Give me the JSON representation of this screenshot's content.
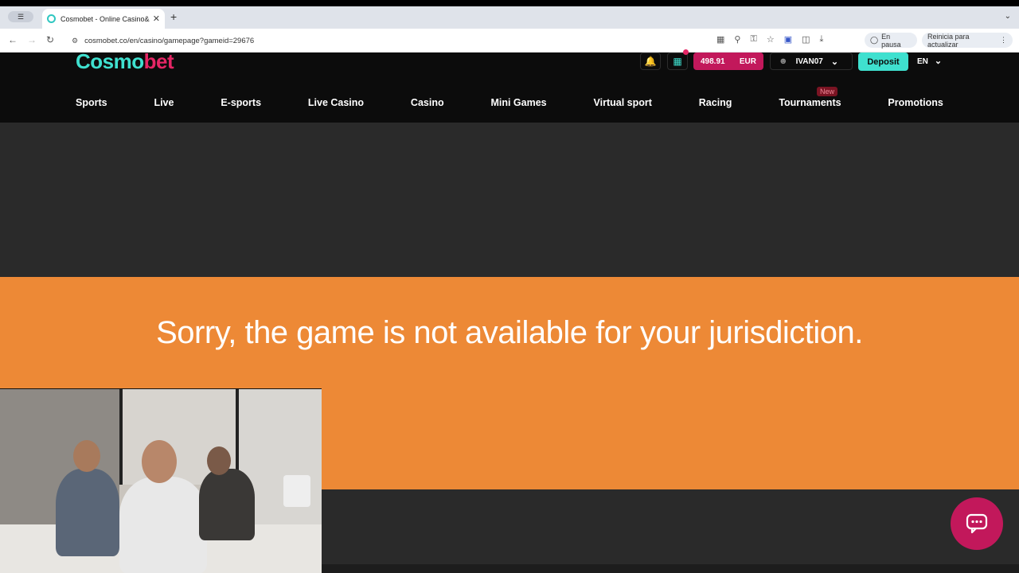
{
  "browser": {
    "tab_title": "Cosmobet - Online Casino&amp;",
    "url": "cosmobet.co/en/casino/gamepage?gameid=29676",
    "pause_label": "En pausa",
    "update_label": "Reinicia para actualizar"
  },
  "header": {
    "logo_part1": "Cosmo",
    "logo_part2": "bet",
    "balance_amount": "498.91",
    "balance_currency": "EUR",
    "username": "IVAN07",
    "deposit_label": "Deposit",
    "language": "EN"
  },
  "nav": {
    "items": [
      "Sports",
      "Live",
      "E-sports",
      "Live Casino",
      "Casino",
      "Mini Games",
      "Virtual sport",
      "Racing",
      "Tournaments",
      "Promotions"
    ],
    "new_badge": "New"
  },
  "main": {
    "message": "Sorry, the game is not available for your jurisdiction."
  },
  "colors": {
    "accent_teal": "#3fe0cf",
    "accent_pink": "#c2185b",
    "banner_orange": "#ed8936"
  }
}
